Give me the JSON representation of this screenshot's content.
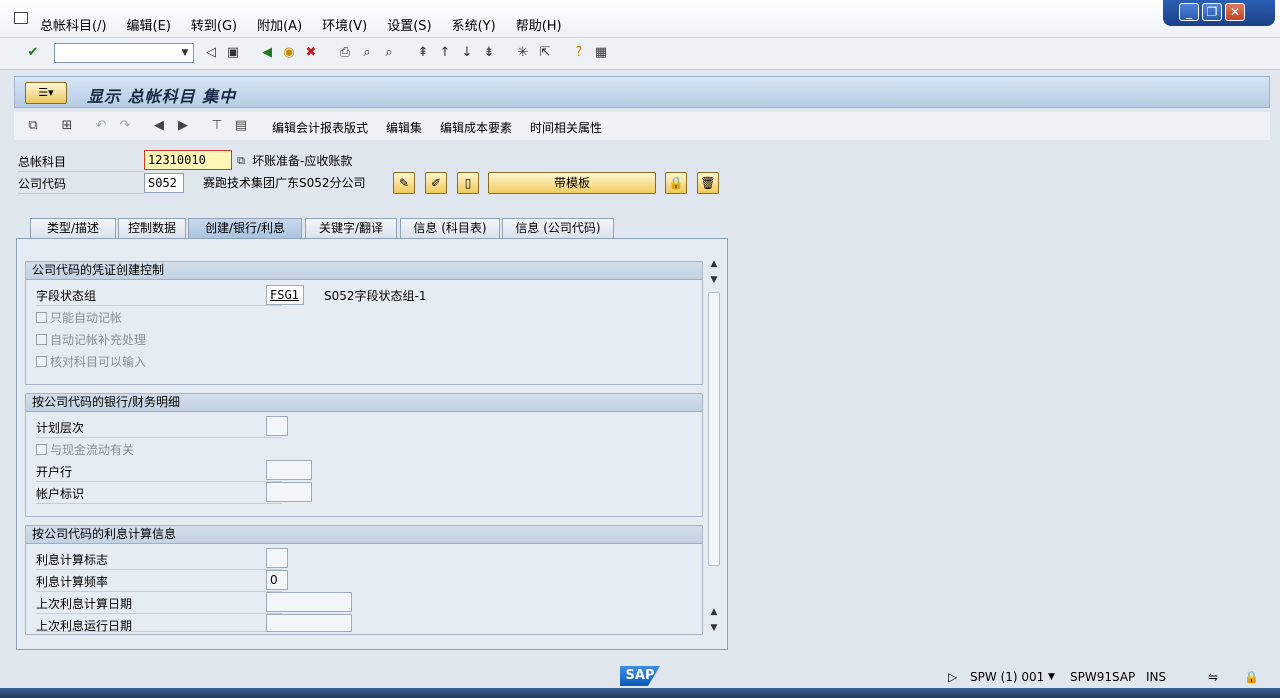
{
  "menu": [
    "总帐科目(/)",
    "编辑(E)",
    "转到(G)",
    "附加(A)",
    "环境(V)",
    "设置(S)",
    "系统(Y)",
    "帮助(H)"
  ],
  "window_controls": [
    "_",
    "❐",
    "✕"
  ],
  "title": "显示 总帐科目 集中",
  "app_toolbar": {
    "edit_report_layout": "编辑会计报表版式",
    "edit_set": "编辑集",
    "edit_cost_element": "编辑成本要素",
    "time_attributes": "时间相关属性"
  },
  "header": {
    "gl_account_label": "总帐科目",
    "gl_account_value": "12310010",
    "gl_account_desc": "坏账准备-应收账款",
    "company_code_label": "公司代码",
    "company_code_value": "S052",
    "company_code_desc": "赛跑技术集团广东S052分公司",
    "template_button": "带模板"
  },
  "tabs": [
    "类型/描述",
    "控制数据",
    "创建/银行/利息",
    "关键字/翻译",
    "信息 (科目表)",
    "信息 (公司代码)"
  ],
  "active_tab": "创建/银行/利息",
  "group1": {
    "title": "公司代码的凭证创建控制",
    "field_status_label": "字段状态组",
    "field_status_value": "FSG1",
    "field_status_desc": "S052字段状态组-1",
    "cb_auto_post": "只能自动记帐",
    "cb_supplement": "自动记帐补充处理",
    "cb_reconcile": "核对科目可以输入"
  },
  "group2": {
    "title": "按公司代码的银行/财务明细",
    "planning_level": "计划层次",
    "cash_flow": "与现金流动有关",
    "house_bank": "开户行",
    "account_id": "帐户标识"
  },
  "group3": {
    "title": "按公司代码的利息计算信息",
    "interest_indicator": "利息计算标志",
    "interest_frequency": "利息计算频率",
    "interest_frequency_value": "0",
    "last_calc_date": "上次利息计算日期",
    "last_run_date": "上次利息运行日期"
  },
  "status": {
    "sap_logo": "SAP",
    "system": "SPW (1) 001",
    "server": "SPW91SAP",
    "mode": "INS"
  }
}
